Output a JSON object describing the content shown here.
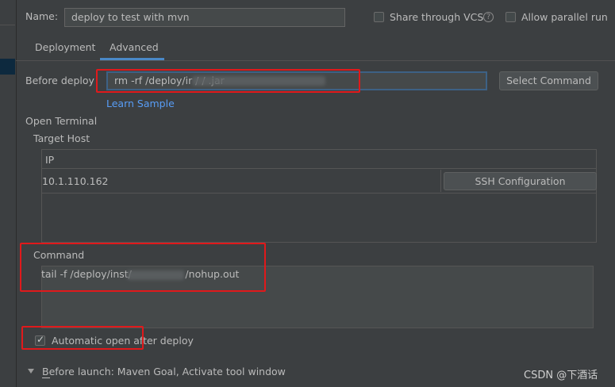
{
  "header": {
    "name_label": "Name:",
    "name_value": "deploy to test with mvn",
    "share_vcs_label": "Share through VCS",
    "share_vcs_checked": false,
    "help_icon": "help-circle-icon",
    "allow_parallel_label": "Allow parallel run",
    "allow_parallel_checked": false
  },
  "tabs": [
    {
      "label": "Deployment",
      "active": false
    },
    {
      "label": "Advanced",
      "active": true
    }
  ],
  "before_deploy": {
    "label": "Before deploy",
    "value": "rm -rf /deploy/ir    /          /     .jar",
    "select_command_label": "Select Command",
    "learn_sample_label": "Learn Sample"
  },
  "open_terminal": {
    "section_label": "Open Terminal",
    "target_host_label": "Target Host",
    "ip_header": "IP",
    "ip_value": "10.1.110.162",
    "ssh_config_label": "SSH Configuration"
  },
  "command": {
    "label": "Command",
    "value": "tail -f /deploy/inst/                 /nohup.out"
  },
  "automatic_open": {
    "label": "Automatic open after deploy",
    "checked": true
  },
  "before_launch": {
    "label": "Before launch: Maven Goal, Activate tool window",
    "expand_icon": "triangle-down-icon"
  },
  "watermark": "CSDN @下酒话",
  "colors": {
    "background": "#3c3f41",
    "highlight_red": "#e0191b",
    "link_blue": "#589df6",
    "tab_underline": "#4a88c7"
  }
}
